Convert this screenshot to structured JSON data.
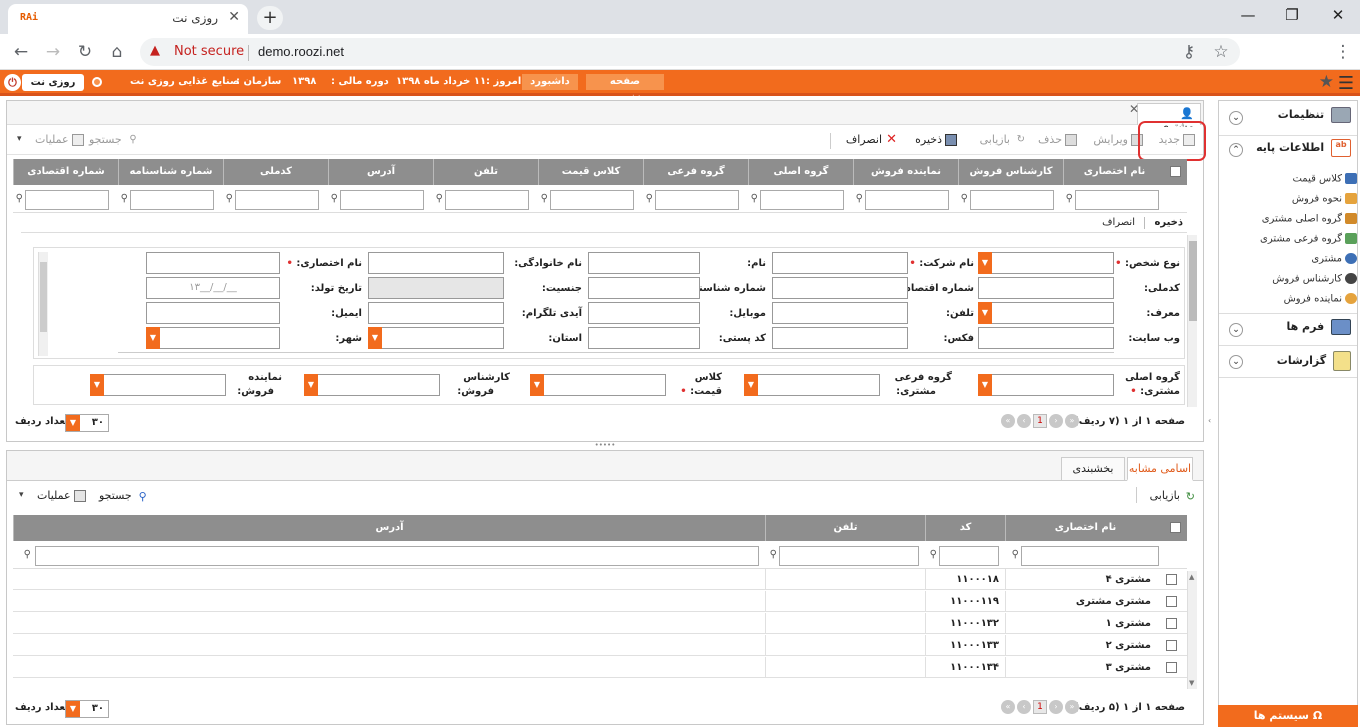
{
  "browser": {
    "tab_title": "روزی نت",
    "favicon_text": "RAi",
    "new_tab": "+",
    "not_secure": "Not secure",
    "url": "demo.roozi.net"
  },
  "topbar": {
    "first_page_btn": "صفحه نخست",
    "dashboard_btn": "داشبورد",
    "today_label": "امروز :",
    "today_value": "۱۱ خرداد ماه ۱۳۹۸",
    "fiscal_label": "دوره مالی :",
    "fiscal_value": "۱۳۹۸",
    "org_label": "سازمان :",
    "org_value": "صنایع غذایی روزی نت",
    "roozi_btn": "روزی نت"
  },
  "sidebar": {
    "settings": "تنظیمات",
    "basic_info": "اطلاعات پایه",
    "items": [
      "کلاس قیمت",
      "نحوه فروش",
      "گروه اصلی مشتری",
      "گروه فرعی مشتری",
      "مشتری",
      "کارشناس فروش",
      "نماینده فروش"
    ],
    "forms": "فرم ها",
    "reports": "گزارشات",
    "system_menu": "سیستم ها"
  },
  "panel_tab": "مشتری",
  "toolbar": {
    "new": "جدید",
    "edit": "ویرایش",
    "delete": "حذف",
    "refresh": "بازیابی",
    "save": "ذخیره",
    "cancel": "انصراف",
    "search": "جستجو",
    "operations": "عملیات"
  },
  "grid": {
    "columns": [
      "نام اختصاری",
      "کارشناس فروش",
      "نماینده فروش",
      "گروه اصلی",
      "گروه فرعی",
      "کلاس قیمت",
      "تلفن",
      "آدرس",
      "کدملی",
      "شماره شناسنامه",
      "شماره اقتصادی"
    ]
  },
  "form": {
    "save": "ذخیره",
    "cancel": "انصراف",
    "labels": {
      "person_type": "نوع شخص:",
      "company_name": "نام شرکت:",
      "first_name": "نام:",
      "last_name": "نام خانوادگی:",
      "short_name": "نام اختصاری:",
      "national_code": "کدملی:",
      "economic_no": "شماره اقتصادی:",
      "id_no": "شماره شناسنامه:",
      "gender": "جنسیت:",
      "birth_date": "تاریخ تولد:",
      "introducer": "معرف:",
      "phone": "تلفن:",
      "mobile": "موبایل:",
      "telegram": "آیدی تلگرام:",
      "email": "ایمیل:",
      "website": "وب سایت:",
      "fax": "فکس:",
      "postal_code": "کد پستی:",
      "province": "استان:",
      "city": "شهر:",
      "main_group_1": "گروه اصلی",
      "main_group_2": "مشتری:",
      "sub_group_1": "گروه فرعی",
      "sub_group_2": "مشتری:",
      "price_class_1": "کلاس",
      "price_class_2": "قیمت:",
      "sales_expert_1": "کارشناس",
      "sales_expert_2": "فروش:",
      "sales_rep_1": "نماینده",
      "sales_rep_2": "فروش:"
    },
    "birth_date_placeholder": "۱۳__/__/__"
  },
  "pager1": {
    "text": "صفحه ۱ از ۱ (۷ ردیف)",
    "page": "1",
    "rows_label": "تعداد ردیف",
    "rows_value": "۳۰"
  },
  "lower": {
    "tabs": [
      "اسامی مشابه",
      "بخشبندی"
    ],
    "refresh": "بازیابی",
    "search": "جستجو",
    "operations": "عملیات",
    "columns": [
      "نام اختصاری",
      "کد",
      "تلفن",
      "آدرس"
    ],
    "rows": [
      {
        "name": "مشتری ۴",
        "code": "۱۱۰۰۰۱۸"
      },
      {
        "name": "مشتری مشتری",
        "code": "۱۱۰۰۰۱۱۹"
      },
      {
        "name": "مشتری ۱",
        "code": "۱۱۰۰۰۱۳۲"
      },
      {
        "name": "مشتری ۲",
        "code": "۱۱۰۰۰۱۳۳"
      },
      {
        "name": "مشتری ۳",
        "code": "۱۱۰۰۰۱۳۴"
      }
    ],
    "pager_text": "صفحه ۱ از ۱ (۵ ردیف)",
    "page": "1",
    "rows_label": "تعداد ردیف",
    "rows_value": "۳۰"
  },
  "colors": {
    "accent": "#f26b1d",
    "header_gray": "#8e8e8e",
    "highlight": "#e03131"
  }
}
